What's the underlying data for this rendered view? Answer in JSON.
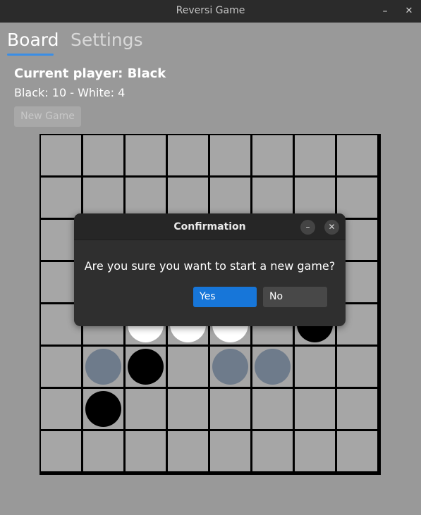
{
  "window": {
    "title": "Reversi Game",
    "minimize_glyph": "–",
    "close_glyph": "✕"
  },
  "tabs": [
    {
      "label": "Board",
      "active": true
    },
    {
      "label": "Settings",
      "active": false
    }
  ],
  "status": {
    "current_player": "Current player: Black",
    "score": "Black: 10 - White: 4"
  },
  "new_game_label": "New Game",
  "board": {
    "size": 8,
    "pieces": [
      {
        "row": 4,
        "col": 2,
        "color": "white"
      },
      {
        "row": 4,
        "col": 3,
        "color": "white"
      },
      {
        "row": 4,
        "col": 4,
        "color": "white"
      },
      {
        "row": 4,
        "col": 6,
        "color": "black"
      },
      {
        "row": 5,
        "col": 1,
        "color": "hint"
      },
      {
        "row": 5,
        "col": 2,
        "color": "black"
      },
      {
        "row": 5,
        "col": 4,
        "color": "hint"
      },
      {
        "row": 5,
        "col": 5,
        "color": "hint"
      },
      {
        "row": 6,
        "col": 1,
        "color": "black"
      }
    ]
  },
  "dialog": {
    "title": "Confirmation",
    "message": "Are you sure you want to start a new game?",
    "yes_label": "Yes",
    "no_label": "No",
    "minimize_glyph": "–",
    "close_glyph": "✕"
  },
  "colors": {
    "accent": "#1776d9",
    "tab_underline": "#3a8ee6",
    "hint_piece": "#6e7b8b"
  }
}
